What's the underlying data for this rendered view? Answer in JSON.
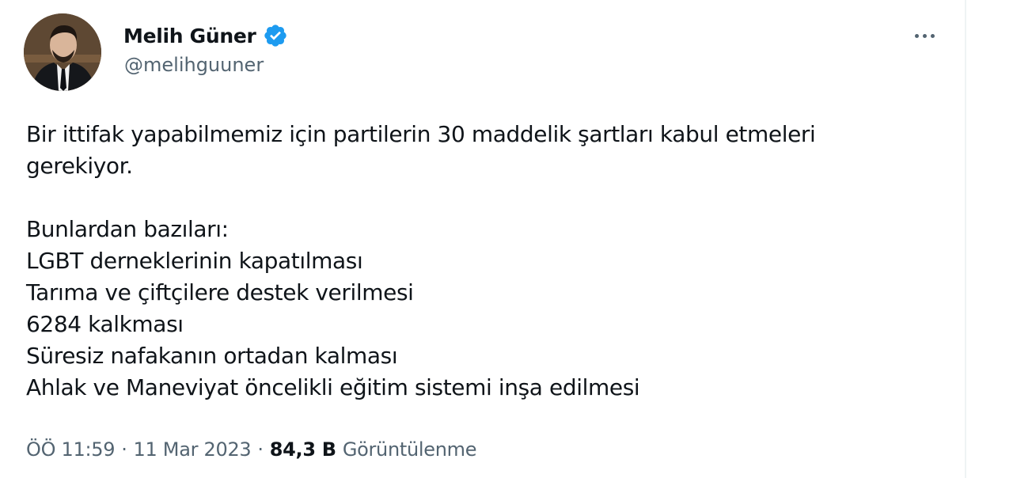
{
  "author": {
    "display_name": "Melih Güner",
    "handle": "@melihguuner",
    "verified": true,
    "verified_color": "#1d9bf0"
  },
  "tweet": {
    "lines": [
      "Bir ittifak yapabilmemiz için partilerin 30 maddelik şartları kabul etmeleri",
      "gerekiyor.",
      "",
      "Bunlardan bazıları:",
      "LGBT derneklerinin kapatılması",
      "Tarıma ve çiftçilere destek verilmesi",
      "6284 kalkması",
      "Süresiz nafakanın ortadan kalması",
      "Ahlak ve Maneviyat öncelikli eğitim sistemi inşa edilmesi"
    ]
  },
  "meta": {
    "time": "ÖÖ 11:59",
    "separator": "·",
    "date": "11 Mar 2023",
    "views_count": "84,3 B",
    "views_label": "Görüntülenme"
  },
  "icons": {
    "more": "more-icon",
    "verified": "verified-badge-icon"
  }
}
